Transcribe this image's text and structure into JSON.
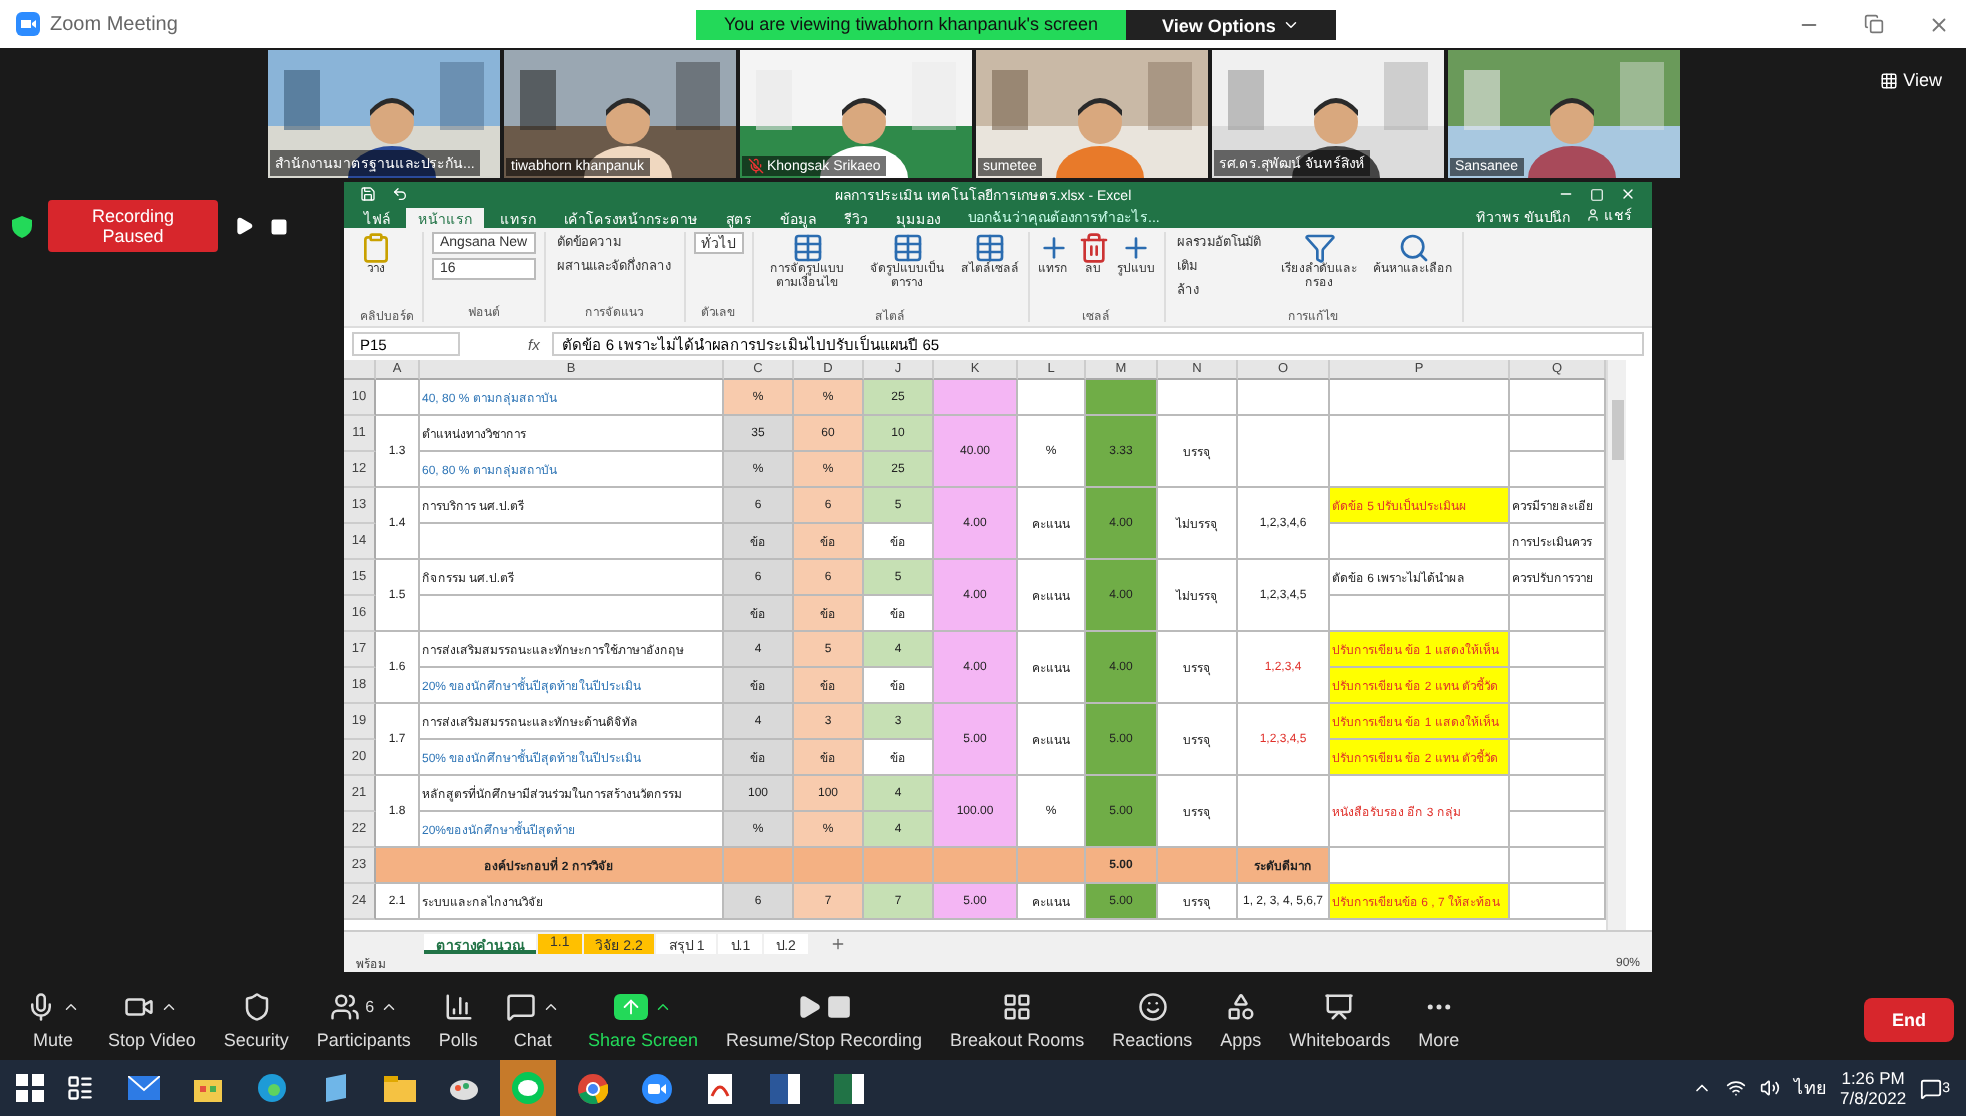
{
  "window": {
    "title": "Zoom Meeting",
    "banner": "You are viewing tiwabhorn khanpanuk's screen",
    "view_options": "View Options",
    "view_button": "View"
  },
  "participants": [
    {
      "name": "สำนักงานมาตรฐานและประกัน...",
      "muted": false
    },
    {
      "name": "tiwabhorn khanpanuk",
      "muted": false
    },
    {
      "name": "Khongsak Srikaeo",
      "muted": true
    },
    {
      "name": "sumetee",
      "muted": false
    },
    {
      "name": "รศ.ดร.สุพัฒน์ จันทร์สิงห์",
      "muted": false
    },
    {
      "name": "Sansanee",
      "muted": false
    }
  ],
  "recording": {
    "label": "Recording Paused"
  },
  "excel": {
    "title": "ผลการประเมิน เทคโนโลยีการเกษตร.xlsx - Excel",
    "user": "ทิวาพร ขันปนึก",
    "share": "แชร์",
    "tell_me": "บอกฉันว่าคุณต้องการทำอะไร...",
    "tabs": [
      {
        "label": "ไฟล์",
        "selected": false
      },
      {
        "label": "หน้าแรก",
        "selected": true
      },
      {
        "label": "แทรก",
        "selected": false
      },
      {
        "label": "เค้าโครงหน้ากระดาษ",
        "selected": false
      },
      {
        "label": "สูตร",
        "selected": false
      },
      {
        "label": "ข้อมูล",
        "selected": false
      },
      {
        "label": "รีวิว",
        "selected": false
      },
      {
        "label": "มุมมอง",
        "selected": false
      }
    ],
    "ribbon": [
      {
        "label": "คลิปบอร์ด",
        "items": [
          {
            "kind": "big",
            "label": "วาง"
          }
        ]
      },
      {
        "label": "ฟอนต์",
        "items": [
          {
            "kind": "field",
            "label": "Angsana New"
          },
          {
            "kind": "field",
            "label": "16"
          }
        ]
      },
      {
        "label": "การจัดแนว",
        "items": [
          {
            "kind": "small",
            "label": "ตัดข้อความ"
          },
          {
            "kind": "small",
            "label": "ผสานและจัดกึ่งกลาง"
          }
        ]
      },
      {
        "label": "ตัวเลข",
        "items": [
          {
            "kind": "field",
            "label": "ทั่วไป"
          }
        ]
      },
      {
        "label": "สไตล์",
        "items": [
          {
            "kind": "big",
            "label": "การจัดรูปแบบตามเงื่อนไข"
          },
          {
            "kind": "big",
            "label": "จัดรูปแบบเป็นตาราง"
          },
          {
            "kind": "big",
            "label": "สไตล์เซลล์"
          }
        ]
      },
      {
        "label": "เซลล์",
        "items": [
          {
            "kind": "big",
            "label": "แทรก"
          },
          {
            "kind": "big",
            "label": "ลบ"
          },
          {
            "kind": "big",
            "label": "รูปแบบ"
          }
        ]
      },
      {
        "label": "การแก้ไข",
        "items": [
          {
            "kind": "small",
            "label": "ผลรวมอัตโนมัติ"
          },
          {
            "kind": "small",
            "label": "เติม"
          },
          {
            "kind": "small",
            "label": "ล้าง"
          },
          {
            "kind": "big",
            "label": "เรียงลำดับและกรอง"
          },
          {
            "kind": "big",
            "label": "ค้นหาและเลือก"
          }
        ]
      }
    ],
    "formula": {
      "name_box": "P15",
      "fx": "fx",
      "content": "ตัดข้อ 6 เพราะไม่ได้นำผลการประเมินไปปรับเป็นแผนปี 65"
    },
    "columns": [
      "A",
      "B",
      "C",
      "D",
      "J",
      "K",
      "L",
      "M",
      "N",
      "O",
      "P",
      "Q"
    ],
    "rows": [
      {
        "number": "10",
        "kind": "data",
        "cells": [
          {
            "kind": "plain"
          },
          {
            "text": "40, 80 % ตามกลุ่มสถาบัน",
            "kind": "subline"
          },
          {
            "text": "%",
            "kind": "peach"
          },
          {
            "text": "%",
            "kind": "peach"
          },
          {
            "text": "25",
            "kind": "green"
          },
          {
            "kind": "pink"
          },
          {
            "kind": "plain"
          },
          {
            "kind": "dgreen"
          },
          {
            "kind": "plain"
          },
          {
            "kind": "plain"
          },
          {
            "kind": "plain"
          },
          {
            "kind": "plain"
          }
        ]
      },
      {
        "number": "11",
        "kind": "data",
        "cells": [
          {
            "text": "1.3",
            "kind": "plain"
          },
          {
            "text": "ตำแหน่งทางวิชาการ",
            "kind": "plain"
          },
          {
            "text": "35",
            "kind": "gray"
          },
          {
            "text": "60",
            "kind": "peach"
          },
          {
            "text": "10",
            "kind": "green"
          },
          {
            "text": "40.00",
            "kind": "pink"
          },
          {
            "text": "%",
            "kind": "plain"
          },
          {
            "text": "3.33",
            "kind": "dgreen"
          },
          {
            "text": "บรรจุ",
            "kind": "plain"
          },
          {
            "kind": "plain"
          },
          {
            "kind": "plain"
          },
          {
            "kind": "plain"
          }
        ]
      },
      {
        "number": "12",
        "kind": "data",
        "cells": [
          null,
          {
            "text": "60, 80 % ตามกลุ่มสถาบัน",
            "kind": "subline"
          },
          {
            "text": "%",
            "kind": "gray"
          },
          {
            "text": "%",
            "kind": "peach"
          },
          {
            "text": "25",
            "kind": "green"
          },
          null,
          null,
          null,
          null,
          null,
          null,
          {
            "kind": "plain"
          }
        ]
      },
      {
        "number": "13",
        "kind": "data",
        "cells": [
          {
            "text": "1.4",
            "kind": "plain"
          },
          {
            "text": "การบริการ นศ.ป.ตรี",
            "kind": "plain"
          },
          {
            "text": "6",
            "kind": "gray"
          },
          {
            "text": "6",
            "kind": "peach"
          },
          {
            "text": "5",
            "kind": "green"
          },
          {
            "text": "4.00",
            "kind": "pink"
          },
          {
            "text": "คะแนน",
            "kind": "plain"
          },
          {
            "text": "4.00",
            "kind": "dgreen"
          },
          {
            "text": "ไม่บรรจุ",
            "kind": "plain"
          },
          {
            "text": "1,2,3,4,6",
            "kind": "plain"
          },
          {
            "text": "ตัดข้อ 5 ปรับเป็นประเมินผ",
            "kind": "warning"
          },
          {
            "text": "ควรมีรายละเอีย",
            "kind": "plain"
          }
        ]
      },
      {
        "number": "14",
        "kind": "data",
        "cells": [
          null,
          {
            "kind": "plain"
          },
          {
            "text": "ข้อ",
            "kind": "gray"
          },
          {
            "text": "ข้อ",
            "kind": "peach"
          },
          {
            "text": "ข้อ",
            "kind": "plain"
          },
          null,
          null,
          null,
          null,
          null,
          {
            "kind": "plain"
          },
          {
            "text": "การประเมินควร",
            "kind": "plain"
          }
        ]
      },
      {
        "number": "15",
        "kind": "data",
        "cells": [
          {
            "text": "1.5",
            "kind": "plain"
          },
          {
            "text": "กิจกรรม นศ.ป.ตรี",
            "kind": "plain"
          },
          {
            "text": "6",
            "kind": "gray"
          },
          {
            "text": "6",
            "kind": "peach"
          },
          {
            "text": "5",
            "kind": "green"
          },
          {
            "text": "4.00",
            "kind": "pink"
          },
          {
            "text": "คะแนน",
            "kind": "plain"
          },
          {
            "text": "4.00",
            "kind": "dgreen"
          },
          {
            "text": "ไม่บรรจุ",
            "kind": "plain"
          },
          {
            "text": "1,2,3,4,5",
            "kind": "plain"
          },
          {
            "text": "ตัดข้อ 6 เพราะไม่ได้นำผล",
            "kind": "plain"
          },
          {
            "text": "ควรปรับการวาย",
            "kind": "plain"
          }
        ]
      },
      {
        "number": "16",
        "kind": "data",
        "cells": [
          null,
          {
            "kind": "plain"
          },
          {
            "text": "ข้อ",
            "kind": "gray"
          },
          {
            "text": "ข้อ",
            "kind": "peach"
          },
          {
            "text": "ข้อ",
            "kind": "plain"
          },
          null,
          null,
          null,
          null,
          null,
          {
            "kind": "plain"
          },
          {
            "kind": "plain"
          }
        ]
      },
      {
        "number": "17",
        "kind": "data",
        "cells": [
          {
            "text": "1.6",
            "kind": "plain"
          },
          {
            "text": "การส่งเสริมสมรรถนะและทักษะการใช้ภาษาอังกฤษ",
            "kind": "plain"
          },
          {
            "text": "4",
            "kind": "gray"
          },
          {
            "text": "5",
            "kind": "peach"
          },
          {
            "text": "4",
            "kind": "green"
          },
          {
            "text": "4.00",
            "kind": "pink"
          },
          {
            "text": "คะแนน",
            "kind": "plain"
          },
          {
            "text": "4.00",
            "kind": "dgreen"
          },
          {
            "text": "บรรจุ",
            "kind": "plain"
          },
          {
            "text": "1,2,3,4",
            "kind": "alert"
          },
          {
            "text": "ปรับการเขียน ข้อ 1 แสดงให้เห็น",
            "kind": "warning"
          },
          {
            "kind": "plain"
          }
        ]
      },
      {
        "number": "18",
        "kind": "data",
        "cells": [
          null,
          {
            "text": "20% ของนักศึกษาชั้นปีสุดท้ายในปีประเมิน",
            "kind": "subline"
          },
          {
            "text": "ข้อ",
            "kind": "gray"
          },
          {
            "text": "ข้อ",
            "kind": "peach"
          },
          {
            "text": "ข้อ",
            "kind": "plain"
          },
          null,
          null,
          null,
          null,
          null,
          {
            "text": "ปรับการเขียน ข้อ 2 แทน ตัวชี้วัด",
            "kind": "warning"
          },
          {
            "kind": "plain"
          }
        ]
      },
      {
        "number": "19",
        "kind": "data",
        "cells": [
          {
            "text": "1.7",
            "kind": "plain"
          },
          {
            "text": "การส่งเสริมสมรรถนะและทักษะด้านดิจิทัล",
            "kind": "plain"
          },
          {
            "text": "4",
            "kind": "gray"
          },
          {
            "text": "3",
            "kind": "peach"
          },
          {
            "text": "3",
            "kind": "green"
          },
          {
            "text": "5.00",
            "kind": "pink"
          },
          {
            "text": "คะแนน",
            "kind": "plain"
          },
          {
            "text": "5.00",
            "kind": "dgreen"
          },
          {
            "text": "บรรจุ",
            "kind": "plain"
          },
          {
            "text": "1,2,3,4,5",
            "kind": "alert"
          },
          {
            "text": "ปรับการเขียน ข้อ 1 แสดงให้เห็น",
            "kind": "warning"
          },
          {
            "kind": "plain"
          }
        ]
      },
      {
        "number": "20",
        "kind": "data",
        "cells": [
          null,
          {
            "text": "50% ของนักศึกษาชั้นปีสุดท้ายในปีประเมิน",
            "kind": "subline"
          },
          {
            "text": "ข้อ",
            "kind": "gray"
          },
          {
            "text": "ข้อ",
            "kind": "peach"
          },
          {
            "text": "ข้อ",
            "kind": "plain"
          },
          null,
          null,
          null,
          null,
          null,
          {
            "text": "ปรับการเขียน ข้อ 2 แทน ตัวชี้วัด",
            "kind": "warning"
          },
          {
            "kind": "plain"
          }
        ]
      },
      {
        "number": "21",
        "kind": "data",
        "cells": [
          {
            "text": "1.8",
            "kind": "plain"
          },
          {
            "text": "หลักสูตรที่นักศึกษามีส่วนร่วมในการสร้างนวัตกรรม",
            "kind": "plain"
          },
          {
            "text": "100",
            "kind": "gray"
          },
          {
            "text": "100",
            "kind": "peach"
          },
          {
            "text": "4",
            "kind": "green"
          },
          {
            "text": "100.00",
            "kind": "pink"
          },
          {
            "text": "%",
            "kind": "plain"
          },
          {
            "text": "5.00",
            "kind": "dgreen"
          },
          {
            "text": "บรรจุ",
            "kind": "plain"
          },
          {
            "kind": "plain"
          },
          {
            "text": "หนังสือรับรอง อีก 3 กลุ่ม",
            "kind": "alert"
          },
          {
            "kind": "plain"
          }
        ]
      },
      {
        "number": "22",
        "kind": "data",
        "cells": [
          null,
          {
            "text": "20%ของนักศึกษาชั้นปีสุดท้าย",
            "kind": "subline"
          },
          {
            "text": "%",
            "kind": "gray"
          },
          {
            "text": "%",
            "kind": "peach"
          },
          {
            "text": "4",
            "kind": "green"
          },
          null,
          null,
          null,
          null,
          null,
          null,
          {
            "kind": "plain"
          }
        ]
      },
      {
        "number": "23",
        "kind": "section",
        "cells": [
          {
            "text": "องค์ประกอบที่ 2 การวิจัย",
            "kind": "orange"
          },
          null,
          {
            "kind": "orange"
          },
          {
            "kind": "orange"
          },
          {
            "kind": "orange"
          },
          {
            "kind": "orange"
          },
          {
            "kind": "orange"
          },
          {
            "text": "5.00",
            "kind": "orange"
          },
          {
            "kind": "orange"
          },
          {
            "text": "ระดับดีมาก",
            "kind": "orange"
          },
          {
            "kind": "plain"
          },
          {
            "kind": "plain"
          }
        ]
      },
      {
        "number": "24",
        "kind": "data",
        "cells": [
          {
            "text": "2.1",
            "kind": "plain"
          },
          {
            "text": "ระบบและกลไกงานวิจัย",
            "kind": "plain"
          },
          {
            "text": "6",
            "kind": "gray"
          },
          {
            "text": "7",
            "kind": "peach"
          },
          {
            "text": "7",
            "kind": "green"
          },
          {
            "text": "5.00",
            "kind": "pink"
          },
          {
            "text": "คะแนน",
            "kind": "plain"
          },
          {
            "text": "5.00",
            "kind": "dgreen"
          },
          {
            "text": "บรรจุ",
            "kind": "plain"
          },
          {
            "text": "1, 2, 3, 4, 5,6,7",
            "kind": "plain"
          },
          {
            "text": "ปรับการเขียนข้อ 6 , 7 ให้สะท้อน",
            "kind": "warning"
          },
          {
            "kind": "plain"
          }
        ]
      }
    ],
    "sheet_tabs": [
      {
        "label": "ตารางคำนวณ",
        "selected": true,
        "color": "#ffffff"
      },
      {
        "label": "1.1",
        "selected": false,
        "color": "#ffc000"
      },
      {
        "label": "วิจัย 2.2",
        "selected": false,
        "color": "#ffc000"
      },
      {
        "label": "สรุป 1",
        "selected": false,
        "color": "#ffffff"
      },
      {
        "label": "ป.1",
        "selected": false,
        "color": "#ffffff"
      },
      {
        "label": "ป.2",
        "selected": false,
        "color": "#ffffff"
      }
    ],
    "status": "พร้อม",
    "zoom": "90%"
  },
  "toolbar": [
    {
      "kind": "mute",
      "label": "Mute",
      "caret": true
    },
    {
      "kind": "video",
      "label": "Stop Video",
      "caret": true
    },
    {
      "kind": "security",
      "label": "Security",
      "caret": false
    },
    {
      "kind": "participants",
      "label": "Participants",
      "count": "6",
      "caret": true
    },
    {
      "kind": "polls",
      "label": "Polls",
      "caret": false
    },
    {
      "kind": "chat",
      "label": "Chat",
      "caret": true
    },
    {
      "kind": "share",
      "label": "Share Screen",
      "caret": true
    },
    {
      "kind": "recording",
      "label": "Resume/Stop Recording",
      "caret": false
    },
    {
      "kind": "breakout",
      "label": "Breakout Rooms",
      "caret": false
    },
    {
      "kind": "reactions",
      "label": "Reactions",
      "caret": false
    },
    {
      "kind": "apps",
      "label": "Apps",
      "caret": false
    },
    {
      "kind": "whiteboards",
      "label": "Whiteboards",
      "caret": false
    },
    {
      "kind": "more",
      "label": "More",
      "caret": false
    }
  ],
  "end_button": "End",
  "taskbar": {
    "apps": [
      {
        "kind": "taskview",
        "active": false
      },
      {
        "kind": "mail",
        "active": false
      },
      {
        "kind": "store",
        "active": false
      },
      {
        "kind": "edge",
        "active": false
      },
      {
        "kind": "notes",
        "active": false
      },
      {
        "kind": "folder",
        "active": false
      },
      {
        "kind": "paint",
        "active": false
      },
      {
        "kind": "chatapp",
        "active": true
      },
      {
        "kind": "chrome",
        "active": false
      },
      {
        "kind": "zoom",
        "active": false
      },
      {
        "kind": "pdf",
        "active": false
      },
      {
        "kind": "word",
        "active": false
      },
      {
        "kind": "excel",
        "active": false
      }
    ],
    "language": "ไทย",
    "time": "1:26 PM",
    "date": "7/8/2022",
    "notifications": "3"
  }
}
